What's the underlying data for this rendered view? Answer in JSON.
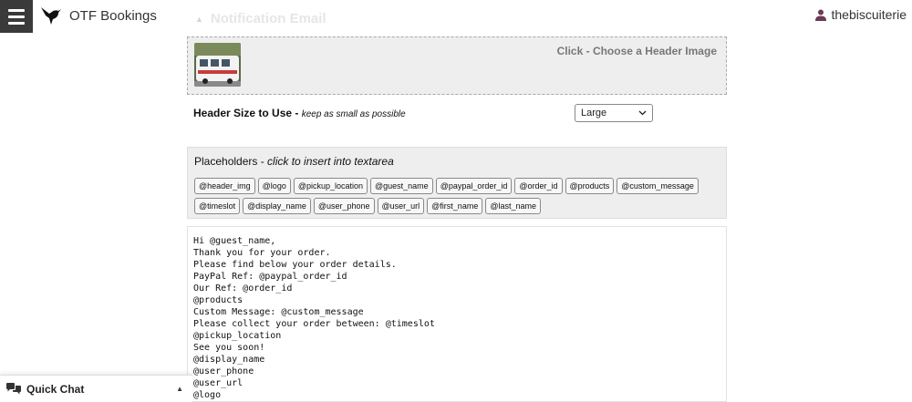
{
  "app": {
    "brand": "OTF Bookings",
    "user": "thebiscuiterie"
  },
  "section": {
    "title": "Notification Email"
  },
  "header_image": {
    "choose_label": "Click - Choose a Header Image"
  },
  "header_size": {
    "label": "Header Size to Use",
    "hint": "keep as small as possible",
    "selected": "Large"
  },
  "placeholders": {
    "title": "Placeholders",
    "hint": "click to insert into textarea",
    "items": [
      "@header_img",
      "@logo",
      "@pickup_location",
      "@guest_name",
      "@paypal_order_id",
      "@order_id",
      "@products",
      "@custom_message",
      "@timeslot",
      "@display_name",
      "@user_phone",
      "@user_url",
      "@first_name",
      "@last_name"
    ]
  },
  "email_body": "Hi @guest_name,\nThank you for your order.\nPlease find below your order details.\nPayPal Ref: @paypal_order_id\nOur Ref: @order_id\n@products\nCustom Message: @custom_message\nPlease collect your order between: @timeslot\n@pickup_location\nSee you soon!\n@display_name\n@user_phone\n@user_url\n@logo",
  "quick_chat": {
    "label": "Quick Chat"
  },
  "icons": {
    "menu": "hamburger-menu-icon",
    "brand": "hummingbird-logo-icon",
    "user": "user-icon",
    "chat": "chat-bubbles-icon"
  }
}
